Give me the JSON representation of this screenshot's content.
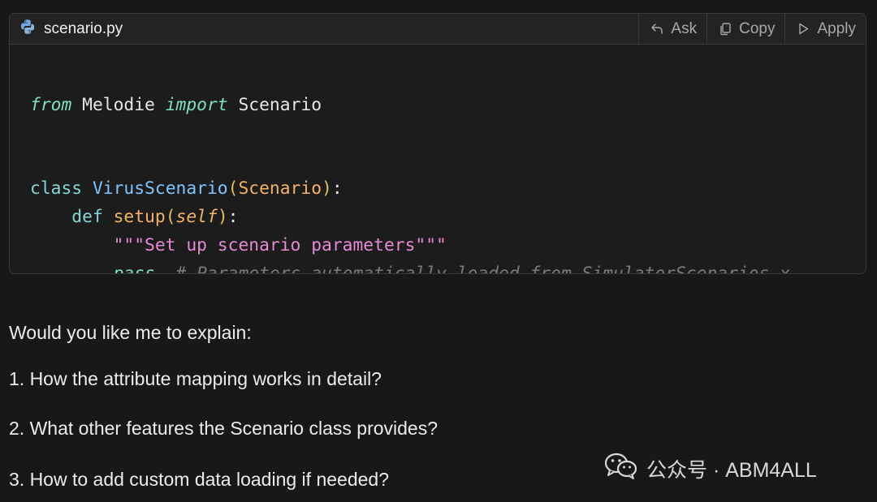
{
  "code_block": {
    "filename": "scenario.py",
    "file_icon": "python-icon",
    "actions": [
      {
        "label": "Ask",
        "icon": "undo-arrow-icon"
      },
      {
        "label": "Copy",
        "icon": "copy-icon"
      },
      {
        "label": "Apply",
        "icon": "play-icon"
      }
    ],
    "lines": {
      "l1": {
        "from": "from",
        "module": " Melodie ",
        "import": "import",
        "name": " Scenario"
      },
      "l4": {
        "class": "class",
        "name": "VirusScenario",
        "open": "(",
        "base": "Scenario",
        "close": ")",
        "colon": ":"
      },
      "l5": {
        "def": "def",
        "name": "setup",
        "open": "(",
        "self": "self",
        "close": ")",
        "colon": ":"
      },
      "l6": {
        "docstring": "\"\"\"Set up scenario parameters\"\"\""
      },
      "l7": {
        "pass": "pass",
        "comment": "# Parameters automatically loaded from SimulatorScenarios.x"
      }
    }
  },
  "message": {
    "intro": "Would you like me to explain:",
    "items": [
      "1. How the attribute mapping works in detail?",
      "2. What other features the Scenario class provides?",
      "3. How to add custom data loading if needed?"
    ]
  },
  "watermark": {
    "text": "公众号 · ABM4ALL",
    "icon": "wechat-icon"
  },
  "colors": {
    "background": "#181818",
    "keyword": "#86d6d6",
    "class_name": "#7fc4ff",
    "function": "#f2b36a",
    "string": "#e78ad6",
    "comment": "#7a7a7a"
  }
}
